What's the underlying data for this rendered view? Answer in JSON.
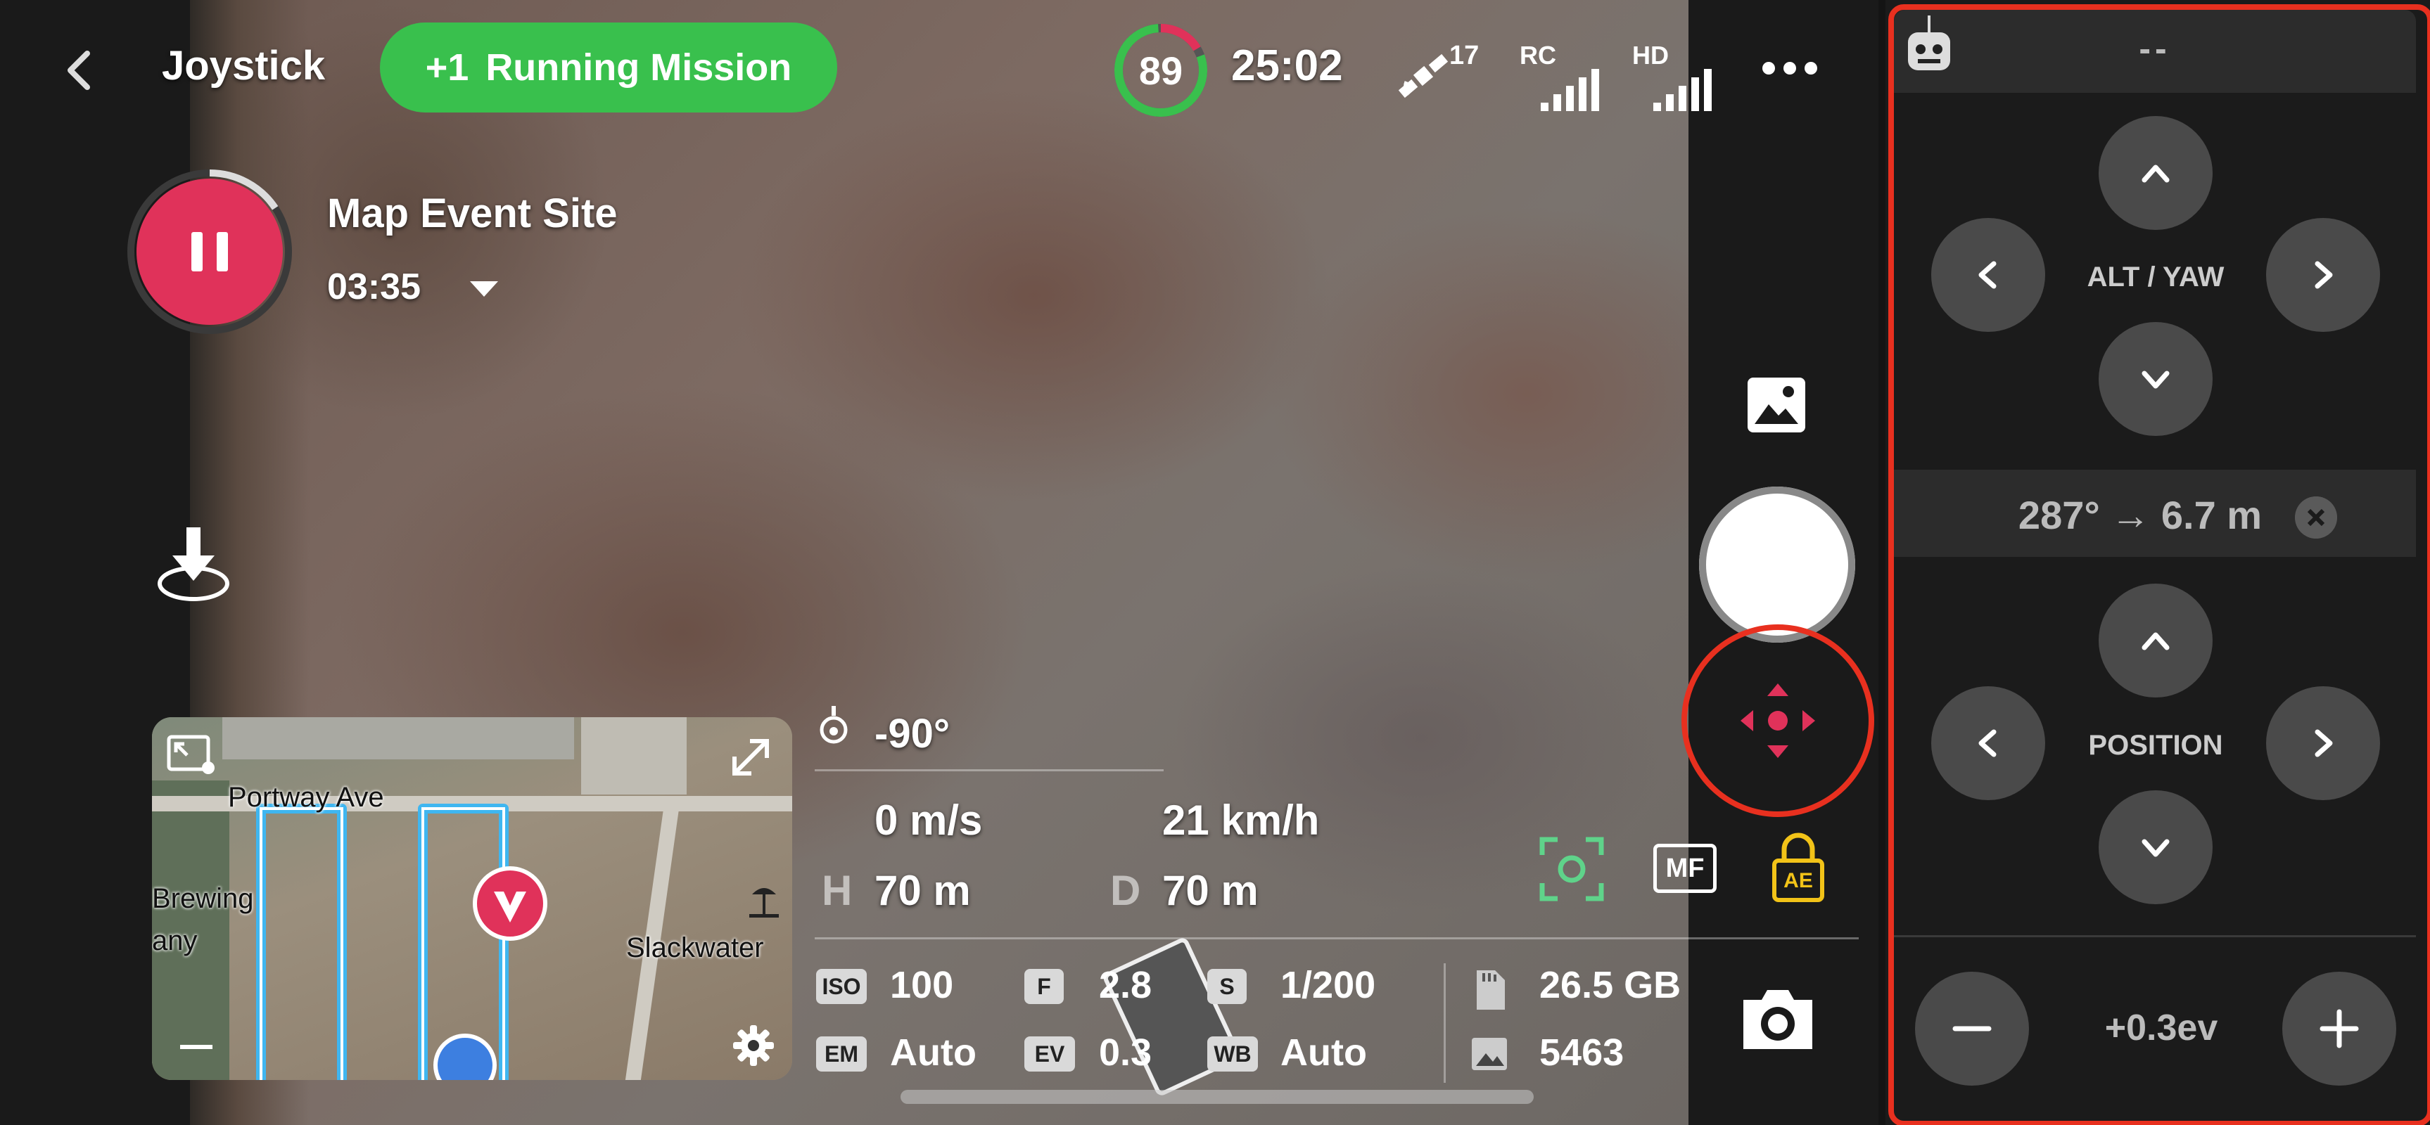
{
  "header": {
    "title": "Joystick",
    "mission_badge_prefix": "+1",
    "mission_badge_label": "Running Mission",
    "battery_percent": "89",
    "flight_time": "25:02",
    "satellite_count": "17",
    "rc_label": "RC",
    "hd_label": "HD"
  },
  "mission": {
    "site_name": "Map Event Site",
    "remaining_time": "03:35"
  },
  "map": {
    "labels": [
      "Portway Ave",
      "Brewing",
      "any",
      "Slackwater"
    ]
  },
  "telemetry": {
    "gimbal_pitch": "-90°",
    "vertical_speed": "0 m/s",
    "horizontal_speed": "21 km/h",
    "height_label": "H",
    "height_value": "70 m",
    "distance_label": "D",
    "distance_value": "70 m"
  },
  "camera": {
    "iso_label": "ISO",
    "iso_value": "100",
    "f_label": "F",
    "f_value": "2.8",
    "s_label": "S",
    "s_value": "1/200",
    "em_label": "EM",
    "em_value": "Auto",
    "ev_label": "EV",
    "ev_value": "0.3",
    "wb_label": "WB",
    "wb_value": "Auto",
    "storage_free": "26.5 GB",
    "photo_count": "5463",
    "mf_label": "MF",
    "ae_label": "AE"
  },
  "joystick_panel": {
    "header_text": "--",
    "alt_yaw_label": "ALT / YAW",
    "position_label": "POSITION",
    "target_readout": "287° → 6.7 m",
    "exposure_value": "+0.3ev"
  },
  "colors": {
    "mission_green": "#39c04d",
    "accent_red": "#e0325a",
    "highlight_outline": "#e8301f",
    "panel_bg": "#1b1b1b",
    "route_blue": "#3fb6f0"
  }
}
